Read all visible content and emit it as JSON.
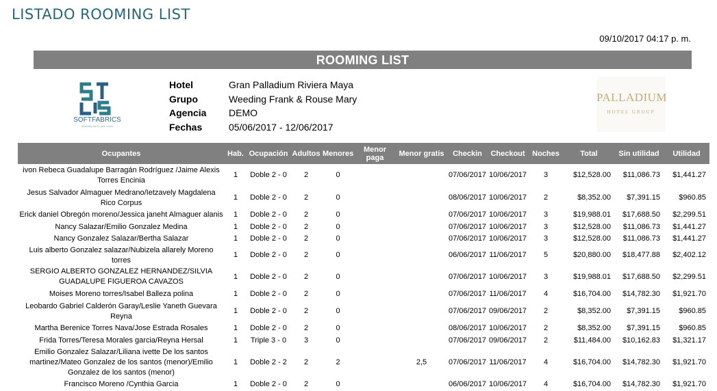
{
  "page_title": "LISTADO ROOMING LIST",
  "print_date": "09/10/2017 04:17 p. m.",
  "banner_title": "ROOMING LIST",
  "logo_left": {
    "brand": "SOFTFABRICS",
    "tagline": "Weeding fan to your event"
  },
  "logo_right": {
    "line1": "PALLADIUM",
    "line2": "HOTEL GROUP"
  },
  "info": [
    {
      "label": "Hotel",
      "value": "Gran Palladium Riviera Maya"
    },
    {
      "label": "Grupo",
      "value": "Weeding Frank & Rouse Mary"
    },
    {
      "label": "Agencia",
      "value": "DEMO"
    },
    {
      "label": "Fechas",
      "value": "05/06/2017 - 12/06/2017"
    }
  ],
  "columns": [
    "Ocupantes",
    "Hab.",
    "Ocupación",
    "Adultos",
    "Menores",
    "Menor paga",
    "Menor gratis",
    "Checkin",
    "Checkout",
    "Noches",
    "Total",
    "Sin utilidad",
    "Utilidad"
  ],
  "rows": [
    {
      "ocupantes": "ivon Rebeca Guadalupe  Barragán Rodríguez /Jaime Alexis Torres Encinia",
      "hab": "1",
      "ocupacion": "Doble 2 - 0",
      "adultos": "2",
      "menores": "0",
      "menor_paga": "",
      "menor_gratis": "",
      "checkin": "07/06/2017",
      "checkout": "10/06/2017",
      "noches": "3",
      "total": "$12,528.00",
      "sin_utilidad": "$11,086.73",
      "utilidad": "$1,441.27"
    },
    {
      "ocupantes": "Jesus Salvador Almaguer Medrano/Ietzavely Magdalena  Rico Corpus",
      "hab": "1",
      "ocupacion": "Doble 2 - 0",
      "adultos": "2",
      "menores": "0",
      "menor_paga": "",
      "menor_gratis": "",
      "checkin": "08/06/2017",
      "checkout": "10/06/2017",
      "noches": "2",
      "total": "$8,352.00",
      "sin_utilidad": "$7,391.15",
      "utilidad": "$960.85"
    },
    {
      "ocupantes": "Erick daniel Obregón moreno/Jessica janeht  Almaguer alanis",
      "hab": "1",
      "ocupacion": "Doble 2 - 0",
      "adultos": "2",
      "menores": "0",
      "menor_paga": "",
      "menor_gratis": "",
      "checkin": "07/06/2017",
      "checkout": "10/06/2017",
      "noches": "3",
      "total": "$19,988.01",
      "sin_utilidad": "$17,688.50",
      "utilidad": "$2,299.51"
    },
    {
      "ocupantes": "Nancy Salazar/Emilio  Gonzalez Medina",
      "hab": "1",
      "ocupacion": "Doble 2 - 0",
      "adultos": "2",
      "menores": "0",
      "menor_paga": "",
      "menor_gratis": "",
      "checkin": "07/06/2017",
      "checkout": "10/06/2017",
      "noches": "3",
      "total": "$12,528.00",
      "sin_utilidad": "$11,086.73",
      "utilidad": "$1,441.27"
    },
    {
      "ocupantes": "Nancy  Gonzalez Salazar/Bertha Salazar",
      "hab": "1",
      "ocupacion": "Doble 2 - 0",
      "adultos": "2",
      "menores": "0",
      "menor_paga": "",
      "menor_gratis": "",
      "checkin": "07/06/2017",
      "checkout": "10/06/2017",
      "noches": "3",
      "total": "$12,528.00",
      "sin_utilidad": "$11,086.73",
      "utilidad": "$1,441.27"
    },
    {
      "ocupantes": "Luis alberto Gonzalez salazar/Nubizela allarely Moreno torres",
      "hab": "1",
      "ocupacion": "Doble 2 - 0",
      "adultos": "2",
      "menores": "0",
      "menor_paga": "",
      "menor_gratis": "",
      "checkin": "06/06/2017",
      "checkout": "11/06/2017",
      "noches": "5",
      "total": "$20,880.00",
      "sin_utilidad": "$18,477.88",
      "utilidad": "$2,402.12"
    },
    {
      "ocupantes": "SERGIO ALBERTO GONZALEZ HERNANDEZ/SILVIA GUADALUPE FIGUEROA CAVAZOS",
      "hab": "1",
      "ocupacion": "Doble 2 - 0",
      "adultos": "2",
      "menores": "0",
      "menor_paga": "",
      "menor_gratis": "",
      "checkin": "07/06/2017",
      "checkout": "10/06/2017",
      "noches": "3",
      "total": "$19,988.01",
      "sin_utilidad": "$17,688.50",
      "utilidad": "$2,299.51"
    },
    {
      "ocupantes": "Moises Moreno torres/Isabel Balleza polina",
      "hab": "1",
      "ocupacion": "Doble 2 - 0",
      "adultos": "2",
      "menores": "0",
      "menor_paga": "",
      "menor_gratis": "",
      "checkin": "07/06/2017",
      "checkout": "11/06/2017",
      "noches": "4",
      "total": "$16,704.00",
      "sin_utilidad": "$14,782.30",
      "utilidad": "$1,921.70"
    },
    {
      "ocupantes": "Leobardo Gabriel  Calderón Garay/Leslie Yaneth Guevara Reyna",
      "hab": "1",
      "ocupacion": "Doble 2 - 0",
      "adultos": "2",
      "menores": "0",
      "menor_paga": "",
      "menor_gratis": "",
      "checkin": "07/06/2017",
      "checkout": "09/06/2017",
      "noches": "2",
      "total": "$8,352.00",
      "sin_utilidad": "$7,391.15",
      "utilidad": "$960.85"
    },
    {
      "ocupantes": "Martha Berenice  Torres Nava/Jose  Estrada Rosales",
      "hab": "1",
      "ocupacion": "Doble 2 - 0",
      "adultos": "2",
      "menores": "0",
      "menor_paga": "",
      "menor_gratis": "",
      "checkin": "08/06/2017",
      "checkout": "10/06/2017",
      "noches": "2",
      "total": "$8,352.00",
      "sin_utilidad": "$7,391.15",
      "utilidad": "$960.85"
    },
    {
      "ocupantes": "Frida Torres/Teresa  Morales garcia/Reyna Hersal",
      "hab": "1",
      "ocupacion": "Triple 3 - 0",
      "adultos": "3",
      "menores": "0",
      "menor_paga": "",
      "menor_gratis": "",
      "checkin": "07/06/2017",
      "checkout": "09/06/2017",
      "noches": "2",
      "total": "$11,484.00",
      "sin_utilidad": "$10,162.83",
      "utilidad": "$1,321.17"
    },
    {
      "ocupantes": "Emilio Gonzalez Salazar/Liliana ivette  De los santos martinez/Mateo  Gonzalez de los santos (menor)/Emilio Gonzalez de los santos (menor)",
      "hab": "1",
      "ocupacion": "Doble 2 - 2",
      "adultos": "2",
      "menores": "2",
      "menor_paga": "",
      "menor_gratis": "2,5",
      "checkin": "07/06/2017",
      "checkout": "11/06/2017",
      "noches": "4",
      "total": "$16,704.00",
      "sin_utilidad": "$14,782.30",
      "utilidad": "$1,921.70"
    },
    {
      "ocupantes": "Francisco  Moreno /Cynthia  Garcia",
      "hab": "1",
      "ocupacion": "Doble 2 - 0",
      "adultos": "2",
      "menores": "0",
      "menor_paga": "",
      "menor_gratis": "",
      "checkin": "06/06/2017",
      "checkout": "10/06/2017",
      "noches": "4",
      "total": "$16,704.00",
      "sin_utilidad": "$14,782.30",
      "utilidad": "$1,921.70"
    }
  ]
}
